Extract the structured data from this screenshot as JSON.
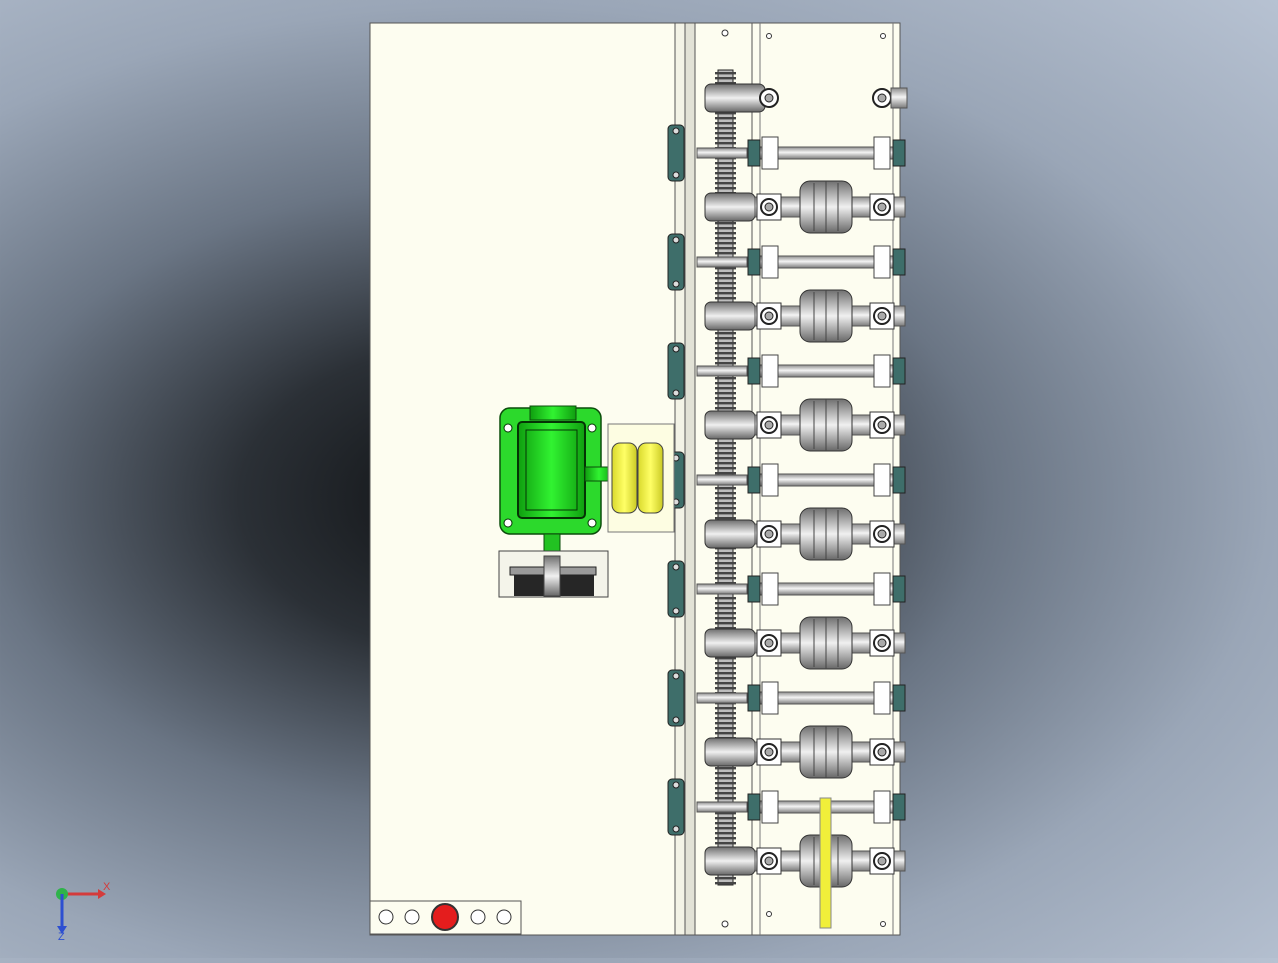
{
  "viewport": {
    "background_colors": [
      "#0e1012",
      "#6a7584",
      "#b7c2d2"
    ],
    "frame_color": "#fdfdf0",
    "motor_color": "#1fe01f",
    "coupling_color": "#f5f542",
    "rail_color": "#e6e6e6",
    "bearing_color": "#3e6e6a"
  },
  "model": {
    "roller_station_count": 7,
    "guide_shaft_count": 6,
    "control_panel_button_count": 5,
    "control_panel_active_button": 2
  },
  "triad": {
    "x_label": "X",
    "z_label": "Z",
    "x_color": "#d43b3b",
    "y_color": "#2fb34a",
    "z_color": "#2d4fd1"
  }
}
